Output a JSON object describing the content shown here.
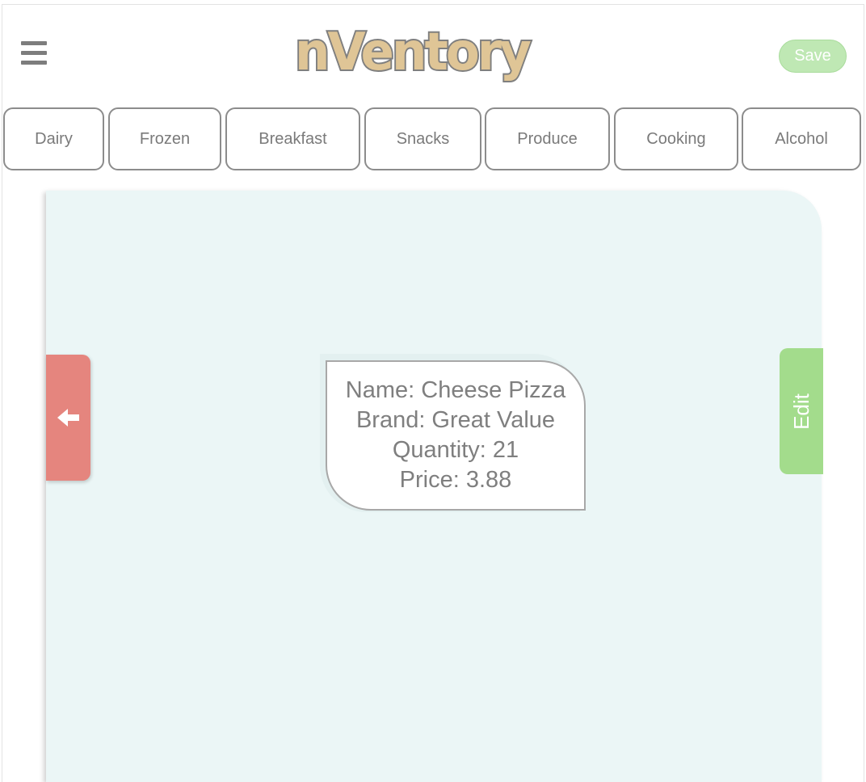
{
  "header": {
    "menu_icon": "hamburger-menu-icon",
    "logo_text": "nVentory",
    "save_label": "Save",
    "colors": {
      "save_bg": "#bfe8b4",
      "logo_fill": "#dfc596",
      "logo_outline": "#7f7f7f"
    }
  },
  "tabs": [
    {
      "label": "Dairy"
    },
    {
      "label": "Frozen"
    },
    {
      "label": "Breakfast"
    },
    {
      "label": "Snacks"
    },
    {
      "label": "Produce"
    },
    {
      "label": "Cooking"
    },
    {
      "label": "Alcohol"
    }
  ],
  "panel": {
    "back_icon": "arrow-left-icon",
    "edit_label": "Edit",
    "colors": {
      "panel_bg": "#ebf6f6",
      "back_bg": "#e5857e",
      "edit_bg": "#a3dc8c"
    }
  },
  "item_card": {
    "name_line": "Name: Cheese Pizza",
    "brand_line": "Brand: Great Value",
    "quantity_line": "Quantity: 21",
    "price_line": "Price: 3.88"
  }
}
